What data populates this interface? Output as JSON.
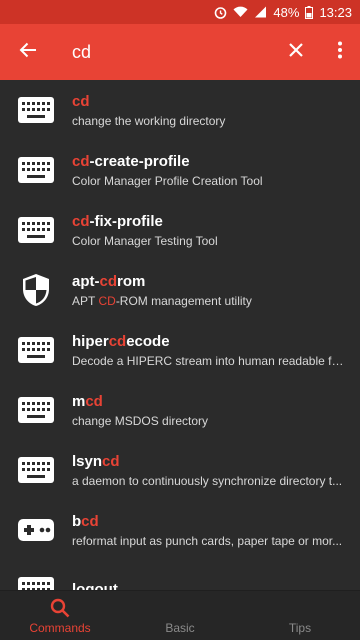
{
  "status_bar": {
    "battery": "48%",
    "time": "13:23"
  },
  "app_bar": {
    "query": "cd",
    "icons": [
      "back-arrow-icon",
      "clear-icon",
      "more-vert-icon"
    ]
  },
  "results": [
    {
      "icon": "keyboard-icon",
      "title_before": "",
      "title_match": "cd",
      "title_after": "",
      "desc_before": "change the working directory",
      "desc_match": "",
      "desc_after": ""
    },
    {
      "icon": "keyboard-icon",
      "title_before": "",
      "title_match": "cd",
      "title_after": "-create-profile",
      "desc_before": "Color Manager Profile Creation Tool",
      "desc_match": "",
      "desc_after": ""
    },
    {
      "icon": "keyboard-icon",
      "title_before": "",
      "title_match": "cd",
      "title_after": "-fix-profile",
      "desc_before": "Color Manager Testing Tool",
      "desc_match": "",
      "desc_after": ""
    },
    {
      "icon": "shield-icon",
      "title_before": "apt-",
      "title_match": "cd",
      "title_after": "rom",
      "desc_before": "APT ",
      "desc_match": "CD",
      "desc_after": "-ROM management utility"
    },
    {
      "icon": "keyboard-icon",
      "title_before": "hiper",
      "title_match": "cd",
      "title_after": "ecode",
      "desc_before": "Decode a HIPERC stream into human readable fo...",
      "desc_match": "",
      "desc_after": ""
    },
    {
      "icon": "keyboard-icon",
      "title_before": "m",
      "title_match": "cd",
      "title_after": "",
      "desc_before": "change MSDOS directory",
      "desc_match": "",
      "desc_after": ""
    },
    {
      "icon": "keyboard-icon",
      "title_before": "lsyn",
      "title_match": "cd",
      "title_after": "",
      "desc_before": "a daemon to continuously synchronize directory t...",
      "desc_match": "",
      "desc_after": ""
    },
    {
      "icon": "gamepad-icon",
      "title_before": "b",
      "title_match": "cd",
      "title_after": "",
      "desc_before": "reformat input as punch cards, paper tape or mor...",
      "desc_match": "",
      "desc_after": ""
    },
    {
      "icon": "keyboard-icon",
      "title_before": "logout",
      "title_match": "",
      "title_after": "",
      "desc_before": "",
      "desc_match": "",
      "desc_after": ""
    }
  ],
  "bottom_nav": [
    {
      "label": "Commands",
      "icon": "search-icon",
      "active": true
    },
    {
      "label": "Basic",
      "icon": "",
      "active": false
    },
    {
      "label": "Tips",
      "icon": "",
      "active": false
    }
  ],
  "colors": {
    "accent": "#e84335",
    "status_bar": "#cd3326",
    "background": "#2b2b2b"
  }
}
